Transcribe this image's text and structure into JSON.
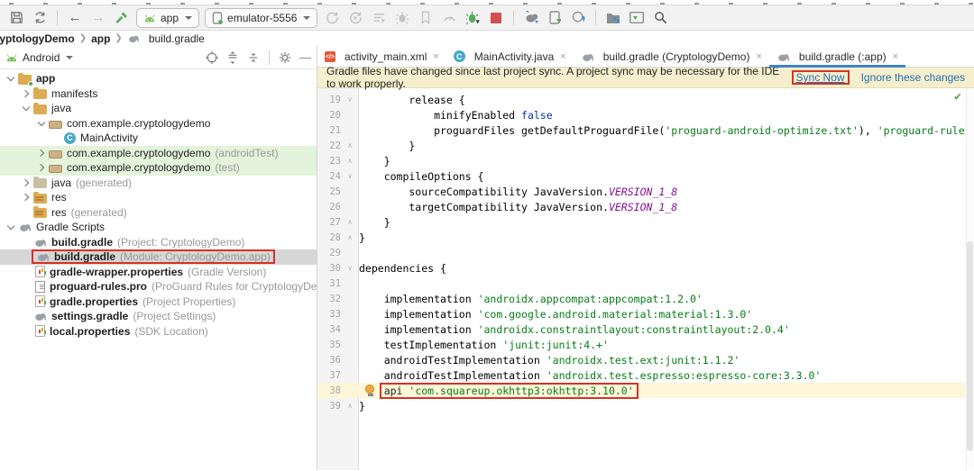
{
  "colors": {
    "accent_blue": "#4083c9",
    "highlight_red": "#d93025",
    "banner_bg": "#f6efce",
    "string_green": "#067d17",
    "keyword_blue": "#0033b3",
    "constant_purple": "#871094",
    "vcs_added_green": "#e4f3dc",
    "selection_gray": "#d6d6d6"
  },
  "toolbar": {
    "run_config": "app",
    "device": "emulator-5556"
  },
  "breadcrumb": {
    "items": [
      "CryptologyDemo",
      "app",
      "build.gradle"
    ]
  },
  "project_panel": {
    "view_selector": "Android",
    "tree": [
      {
        "label": "app",
        "bold": true,
        "icon": "folder-app",
        "expander": "open",
        "indent": 0
      },
      {
        "label": "manifests",
        "icon": "folder",
        "expander": "closed",
        "indent": 1
      },
      {
        "label": "java",
        "icon": "folder",
        "expander": "open",
        "indent": 1
      },
      {
        "label": "com.example.cryptologydemo",
        "icon": "package",
        "expander": "open",
        "indent": 2
      },
      {
        "label": "MainActivity",
        "icon": "class",
        "indent": 3
      },
      {
        "label": "com.example.cryptologydemo",
        "annotation": "(androidTest)",
        "icon": "package",
        "expander": "closed",
        "indent": 2,
        "highlight": "green"
      },
      {
        "label": "com.example.cryptologydemo",
        "annotation": "(test)",
        "icon": "package",
        "expander": "closed",
        "indent": 2,
        "highlight": "green"
      },
      {
        "label": "java",
        "annotation": "(generated)",
        "icon": "folder-gen",
        "expander": "closed",
        "indent": 1
      },
      {
        "label": "res",
        "icon": "folder-res",
        "expander": "closed",
        "indent": 1
      },
      {
        "label": "res",
        "annotation": "(generated)",
        "icon": "folder-res",
        "indent": 1
      },
      {
        "label": "Gradle Scripts",
        "icon": "gradle",
        "expander": "open",
        "indent": 0
      },
      {
        "label": "build.gradle",
        "bold": true,
        "annotation": "(Project: CryptologyDemo)",
        "icon": "gradle",
        "indent": 1
      },
      {
        "label": "build.gradle",
        "bold": true,
        "annotation": "(Module: CryptologyDemo.app)",
        "icon": "gradle",
        "indent": 1,
        "selected": true,
        "redbox": true
      },
      {
        "label": "gradle-wrapper.properties",
        "bold": true,
        "annotation": "(Gradle Version)",
        "icon": "properties",
        "indent": 1
      },
      {
        "label": "proguard-rules.pro",
        "bold": true,
        "annotation": "(ProGuard Rules for CryptologyDemo.app)",
        "icon": "file",
        "indent": 1
      },
      {
        "label": "gradle.properties",
        "bold": true,
        "annotation": "(Project Properties)",
        "icon": "properties",
        "indent": 1
      },
      {
        "label": "settings.gradle",
        "bold": true,
        "annotation": "(Project Settings)",
        "icon": "gradle",
        "indent": 1
      },
      {
        "label": "local.properties",
        "bold": true,
        "annotation": "(SDK Location)",
        "icon": "properties",
        "indent": 1
      }
    ]
  },
  "editor": {
    "tabs": [
      {
        "label": "activity_main.xml",
        "icon": "xml",
        "active": false
      },
      {
        "label": "MainActivity.java",
        "icon": "class",
        "active": false
      },
      {
        "label": "build.gradle (CryptologyDemo)",
        "icon": "gradle",
        "active": false
      },
      {
        "label": "build.gradle (:app)",
        "icon": "gradle",
        "active": true
      }
    ],
    "notification": {
      "message": "Gradle files have changed since last project sync. A project sync may be necessary for the IDE to work properly.",
      "actions": [
        {
          "label": "Sync Now",
          "redbox": true
        },
        {
          "label": "Ignore these changes",
          "redbox": false
        }
      ]
    },
    "inspections_status": "ok",
    "code": {
      "lines": [
        {
          "n": 19,
          "fold": "open",
          "segs": [
            {
              "t": "        release {"
            }
          ]
        },
        {
          "n": 20,
          "segs": [
            {
              "t": "            minifyEnabled "
            },
            {
              "t": "false",
              "c": "kw"
            }
          ]
        },
        {
          "n": 21,
          "segs": [
            {
              "t": "            proguardFiles getDefaultProguardFile("
            },
            {
              "t": "'proguard-android-optimize.txt'",
              "c": "str"
            },
            {
              "t": "), "
            },
            {
              "t": "'proguard-rules.pro'",
              "c": "str"
            }
          ]
        },
        {
          "n": 22,
          "fold": "close",
          "segs": [
            {
              "t": "        }"
            }
          ]
        },
        {
          "n": 23,
          "fold": "close",
          "segs": [
            {
              "t": "    }"
            }
          ]
        },
        {
          "n": 24,
          "fold": "open",
          "segs": [
            {
              "t": "    compileOptions {"
            }
          ]
        },
        {
          "n": 25,
          "segs": [
            {
              "t": "        sourceCompatibility JavaVersion."
            },
            {
              "t": "VERSION_1_8",
              "c": "const"
            }
          ]
        },
        {
          "n": 26,
          "segs": [
            {
              "t": "        targetCompatibility JavaVersion."
            },
            {
              "t": "VERSION_1_8",
              "c": "const"
            }
          ]
        },
        {
          "n": 27,
          "fold": "close",
          "segs": [
            {
              "t": "    }"
            }
          ]
        },
        {
          "n": 28,
          "fold": "close",
          "segs": [
            {
              "t": "}"
            }
          ]
        },
        {
          "n": 29,
          "segs": []
        },
        {
          "n": 30,
          "fold": "open",
          "segs": [
            {
              "t": "dependencies {"
            }
          ]
        },
        {
          "n": 31,
          "segs": []
        },
        {
          "n": 32,
          "segs": [
            {
              "t": "    implementation "
            },
            {
              "t": "'androidx.appcompat:appcompat:1.2.0'",
              "c": "str"
            }
          ]
        },
        {
          "n": 33,
          "segs": [
            {
              "t": "    implementation "
            },
            {
              "t": "'com.google.android.material:material:1.3.0'",
              "c": "str"
            }
          ]
        },
        {
          "n": 34,
          "segs": [
            {
              "t": "    implementation "
            },
            {
              "t": "'androidx.constraintlayout:constraintlayout:2.0.4'",
              "c": "str"
            }
          ]
        },
        {
          "n": 35,
          "segs": [
            {
              "t": "    testImplementation "
            },
            {
              "t": "'junit:junit:4.+'",
              "c": "str"
            }
          ]
        },
        {
          "n": 36,
          "segs": [
            {
              "t": "    androidTestImplementation "
            },
            {
              "t": "'androidx.test.ext:junit:1.1.2'",
              "c": "str"
            }
          ]
        },
        {
          "n": 37,
          "segs": [
            {
              "t": "    androidTestImplementation "
            },
            {
              "t": "'androidx.test.espresso:espresso-core:3.3.0'",
              "c": "str"
            }
          ]
        },
        {
          "n": 38,
          "current": true,
          "bulb": true,
          "segs": [
            {
              "t": "    "
            }
          ],
          "boxed": [
            {
              "t": "api "
            },
            {
              "t": "'com.squareup.okhttp3:okhttp:3.10.0'",
              "c": "str"
            }
          ]
        },
        {
          "n": 39,
          "fold": "close",
          "segs": [
            {
              "t": "}"
            }
          ]
        }
      ]
    }
  }
}
